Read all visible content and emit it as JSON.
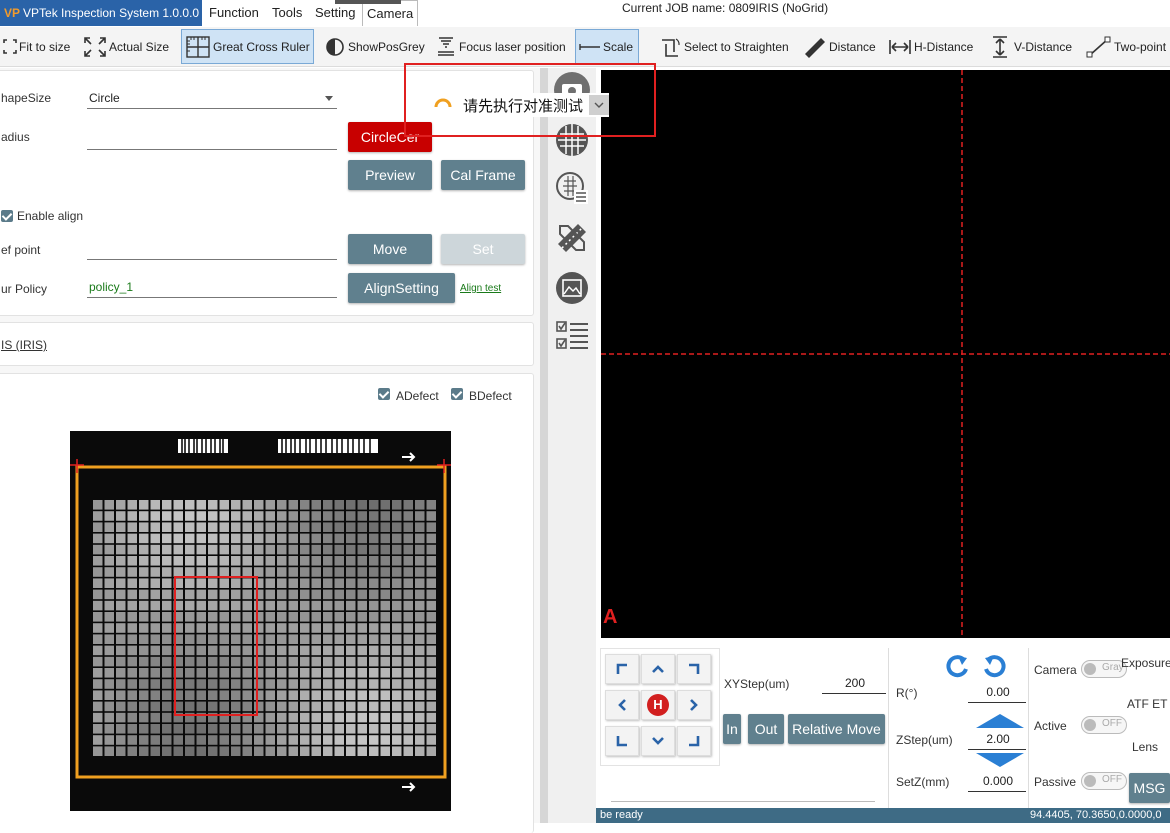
{
  "app": {
    "title": "VPTek Inspection System 1.0.0.0",
    "logo": "VP",
    "menu": [
      "Function",
      "Tools",
      "Setting",
      "Camera"
    ],
    "current_job": "Current JOB name:  0809IRIS (NoGrid)"
  },
  "toolbar": [
    {
      "icon": "fit-to-size-icon",
      "label": "Fit to size"
    },
    {
      "icon": "actual-size-icon",
      "label": "Actual Size"
    },
    {
      "icon": "cross-ruler-icon",
      "label": "Great Cross Ruler"
    },
    {
      "icon": "contrast-icon",
      "label": "ShowPosGrey"
    },
    {
      "icon": "focus-laser-icon",
      "label": "Focus laser position"
    },
    {
      "icon": "scale-line-icon",
      "label": "Scale"
    },
    {
      "icon": "straighten-icon",
      "label": "Select to Straighten"
    },
    {
      "icon": "ruler-icon",
      "label": "Distance"
    },
    {
      "icon": "h-distance-icon",
      "label": "H-Distance"
    },
    {
      "icon": "v-distance-icon",
      "label": "V-Distance"
    },
    {
      "icon": "two-point-icon",
      "label": "Two-point"
    }
  ],
  "form": {
    "shape_label": "hapeSize",
    "shape_value": "Circle",
    "radius_label": "adius",
    "radius_value": "",
    "circle_btn": "CircleCer",
    "preview_btn": "Preview",
    "calframe_btn": "Cal Frame",
    "enable_align": "Enable align",
    "refpoint_label": "ef point",
    "refpoint_value": "",
    "move_btn": "Move",
    "set_btn": "Set",
    "policy_label": "ur Policy",
    "policy_value": "policy_1",
    "alignsetting_btn": "AlignSetting",
    "align_test": "Align test"
  },
  "iris_link": "IS (IRIS)",
  "defects": {
    "a": "ADefect",
    "b": "BDefect"
  },
  "popup": {
    "message": "请先执行对准测试"
  },
  "camera": {
    "marker": "A"
  },
  "jog": {
    "home": "H",
    "xystep_label": "XYStep(um)",
    "xystep_value": "200",
    "in_btn": "In",
    "out_btn": "Out",
    "relmove_btn": "Relative Move",
    "r_label": "R(°)",
    "r_value": "0.00",
    "zstep_label": "ZStep(um)",
    "zstep_value": "2.00",
    "setz_label": "SetZ(mm)",
    "setz_value": "0.000"
  },
  "right_controls": {
    "camera_label": "Camera",
    "camera_toggle": "Gray",
    "exposure_label": "Exposure",
    "atf_label": "ATF ET",
    "active_label": "Active",
    "active_toggle": "OFF",
    "lens_label": "Lens",
    "passive_label": "Passive",
    "passive_toggle": "OFF",
    "msg_btn": "MSG"
  },
  "status": {
    "left": "be ready",
    "right": "94.4405, 70.3650,0.0000,0"
  },
  "colors": {
    "accent": "#2a63a8",
    "button": "#60808e",
    "danger": "#c80000",
    "crosshair": "#e02020",
    "frame": "#f0a020"
  }
}
